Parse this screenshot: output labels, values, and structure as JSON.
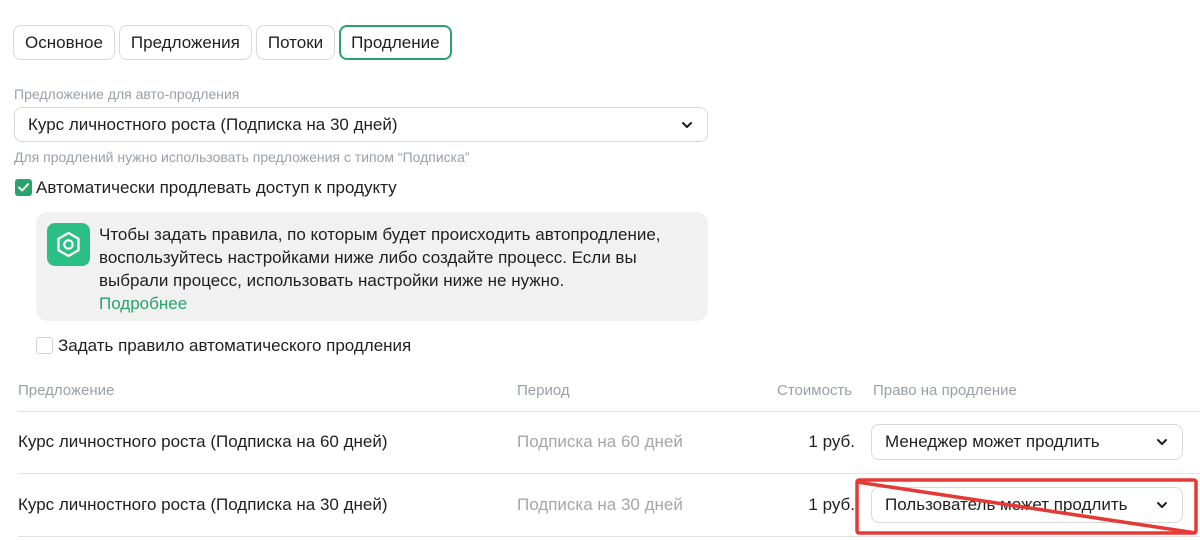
{
  "tabs": [
    {
      "label": "Основное",
      "active": false
    },
    {
      "label": "Предложения",
      "active": false
    },
    {
      "label": "Потоки",
      "active": false
    },
    {
      "label": "Продление",
      "active": true
    }
  ],
  "auto_renewal": {
    "label": "Предложение для авто-продления",
    "selected_offer": "Курс личностного роста (Подписка на 30 дней)",
    "hint": "Для продлений нужно использовать предложения с типом “Подписка”"
  },
  "auto_extend_checkbox": {
    "label": "Автоматически продлевать доступ к продукту",
    "checked": true
  },
  "info": {
    "icon": "hexagon-nut-icon",
    "line1": "Чтобы задать правила, по которым будет происходить автопродление,",
    "line2": "воспользуйтесь настройками ниже либо создайте процесс. Если вы",
    "line3": "выбрали процесс, использовать настройки ниже не нужно.",
    "link": "Подробнее"
  },
  "rule_checkbox": {
    "label": "Задать правило автоматического продления",
    "checked": false
  },
  "table": {
    "headers": {
      "offer": "Предложение",
      "period": "Период",
      "price": "Стоимость",
      "right": "Право на продление"
    },
    "rows": [
      {
        "offer": "Курс личностного роста (Подписка на 60 дней)",
        "period": "Подписка на 60 дней",
        "price": "1 руб.",
        "right": "Менеджер может продлить"
      },
      {
        "offer": "Курс личностного роста (Подписка на 30 дней)",
        "period": "Подписка на 30 дней",
        "price": "1 руб.",
        "right": "Пользователь может продлить"
      }
    ]
  },
  "colors": {
    "accent": "#27a36b",
    "icon_bg": "#2bbf86",
    "annotation": "#e53935"
  }
}
